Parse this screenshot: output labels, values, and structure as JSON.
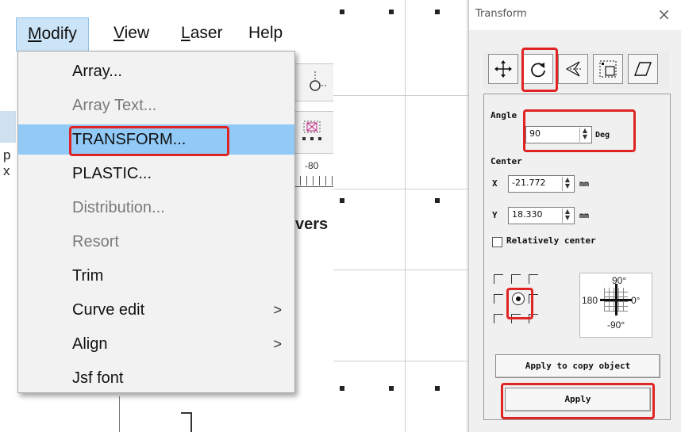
{
  "menubar": {
    "items": [
      {
        "label": "Modify",
        "accel": "M"
      },
      {
        "label": "View",
        "accel": "V"
      },
      {
        "label": "Laser",
        "accel": "L"
      },
      {
        "label": "Help",
        "accel": ""
      }
    ]
  },
  "modify_menu": {
    "items": [
      {
        "label": "Array...",
        "enabled": true
      },
      {
        "label": "Array Text...",
        "enabled": false
      },
      {
        "label": "TRANSFORM...",
        "enabled": true,
        "selected": true
      },
      {
        "label": "PLASTIC...",
        "enabled": true
      },
      {
        "label": "Distribution...",
        "enabled": false
      },
      {
        "label": "Resort",
        "enabled": false
      },
      {
        "label": "Trim",
        "enabled": true
      },
      {
        "label": "Curve edit",
        "enabled": true,
        "submenu": true,
        "arrow": ">"
      },
      {
        "label": "Align",
        "enabled": true,
        "submenu": true,
        "arrow": ">"
      },
      {
        "label": "Jsf font",
        "enabled": true
      }
    ]
  },
  "background": {
    "ruler_label": "-80",
    "partial_text": "vers",
    "left_fragments": [
      "p",
      "x"
    ]
  },
  "transform_dialog": {
    "title": "Transform",
    "close_glyph": "×",
    "tools": [
      "move-icon",
      "rotate-icon",
      "mirror-icon",
      "scale-icon",
      "skew-icon"
    ],
    "selected_tool": "rotate-icon",
    "angle": {
      "label": "Angle",
      "value": "90",
      "unit": "Deg"
    },
    "center": {
      "label": "Center",
      "x": {
        "label": "X",
        "value": "-21.772",
        "unit": "mm"
      },
      "y": {
        "label": "Y",
        "value": "18.330",
        "unit": "mm"
      }
    },
    "relatively_center": {
      "label": "Relatively center",
      "checked": false
    },
    "compass": {
      "top": "90°",
      "left": "180",
      "right": "0°",
      "bottom": "-90°"
    },
    "apply_copy_label": "Apply to copy object",
    "apply_label": "Apply"
  },
  "highlight_color": "#e02424"
}
